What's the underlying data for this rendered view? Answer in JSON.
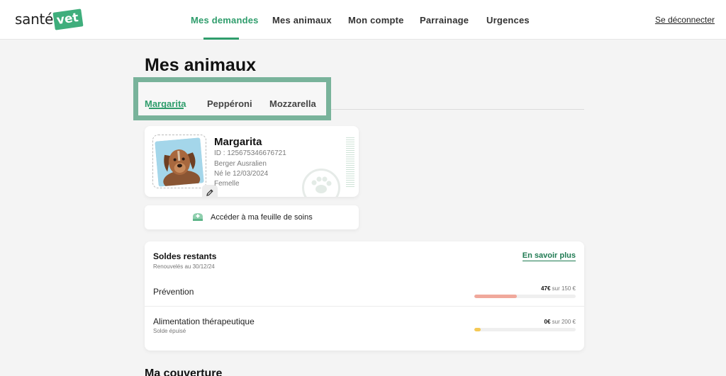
{
  "header": {
    "logo_text": "santé",
    "logo_badge": "vet",
    "nav": [
      {
        "label": "Mes demandes",
        "active": true
      },
      {
        "label": "Mes animaux",
        "active": false
      },
      {
        "label": "Mon compte",
        "active": false
      },
      {
        "label": "Parrainage",
        "active": false
      },
      {
        "label": "Urgences",
        "active": false
      }
    ],
    "logout_label": "Se déconnecter"
  },
  "page": {
    "title": "Mes animaux",
    "tabs": [
      {
        "label": "Margarita",
        "active": true
      },
      {
        "label": "Peppéroni",
        "active": false
      },
      {
        "label": "Mozzarella",
        "active": false
      }
    ]
  },
  "pet": {
    "name": "Margarita",
    "id_line": "ID : 125675346676721",
    "breed": "Berger Ausralien",
    "birth": "Né le 12/03/2024",
    "sex": "Femelle",
    "icons": {
      "edit": "pencil-icon",
      "watermark": "paw-icon"
    }
  },
  "care_sheet": {
    "label": "Accéder à ma feuille de soins",
    "icon": "medical-kit-icon"
  },
  "balances": {
    "title": "Soldes restants",
    "subtitle": "Renouvelés au 30/12/24",
    "learn_more": "En savoir plus",
    "rows": [
      {
        "label": "Prévention",
        "sub": "",
        "amount": "47€",
        "total": "sur 150 €",
        "fraction": 0.42,
        "color": "#f0a89b"
      },
      {
        "label": "Alimentation thérapeutique",
        "sub": "Solde épuisé",
        "amount": "0€",
        "total": "sur 200 €",
        "fraction": 0.06,
        "color": "#f5c955"
      }
    ]
  },
  "next_section_title": "Ma couverture",
  "colors": {
    "accent": "#2f9d6c",
    "highlight_frame": "#79b39b"
  }
}
